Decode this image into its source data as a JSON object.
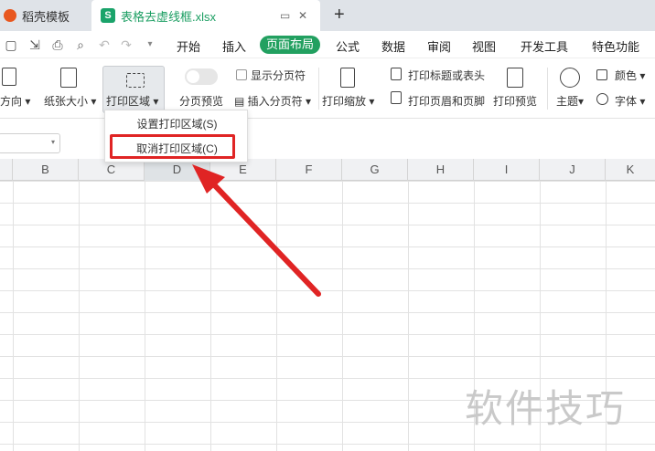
{
  "tabs": [
    {
      "label": "稻壳模板"
    },
    {
      "label": "表格去虚线框.xlsx",
      "badge": "S"
    }
  ],
  "menu": {
    "items": [
      "开始",
      "插入",
      "页面布局",
      "公式",
      "数据",
      "审阅",
      "视图",
      "开发工具",
      "特色功能"
    ],
    "active": "页面布局"
  },
  "ribbon": {
    "orientation": "纸张方向",
    "orientation_visible": "方向",
    "paper_size": "纸张大小",
    "print_area": "打印区域",
    "page_preview": "分页预览",
    "show_page_breaks": "显示分页符",
    "insert_page_break": "插入分页符",
    "print_scale": "打印缩放",
    "print_titles": "打印标题或表头",
    "print_header_footer": "打印页眉和页脚",
    "print_preview": "打印预览",
    "theme": "主题",
    "colors": "颜色",
    "fonts": "字体"
  },
  "dropdown": {
    "items": [
      "设置打印区域(S)",
      "取消打印区域(C)"
    ],
    "highlighted": "取消打印区域(C)"
  },
  "columns": [
    "B",
    "C",
    "D",
    "E",
    "F",
    "G",
    "H",
    "I",
    "J",
    "K"
  ],
  "selected_column": "D",
  "watermark": "软件技巧",
  "colors": {
    "accent": "#22a060",
    "highlight": "#e02424"
  }
}
